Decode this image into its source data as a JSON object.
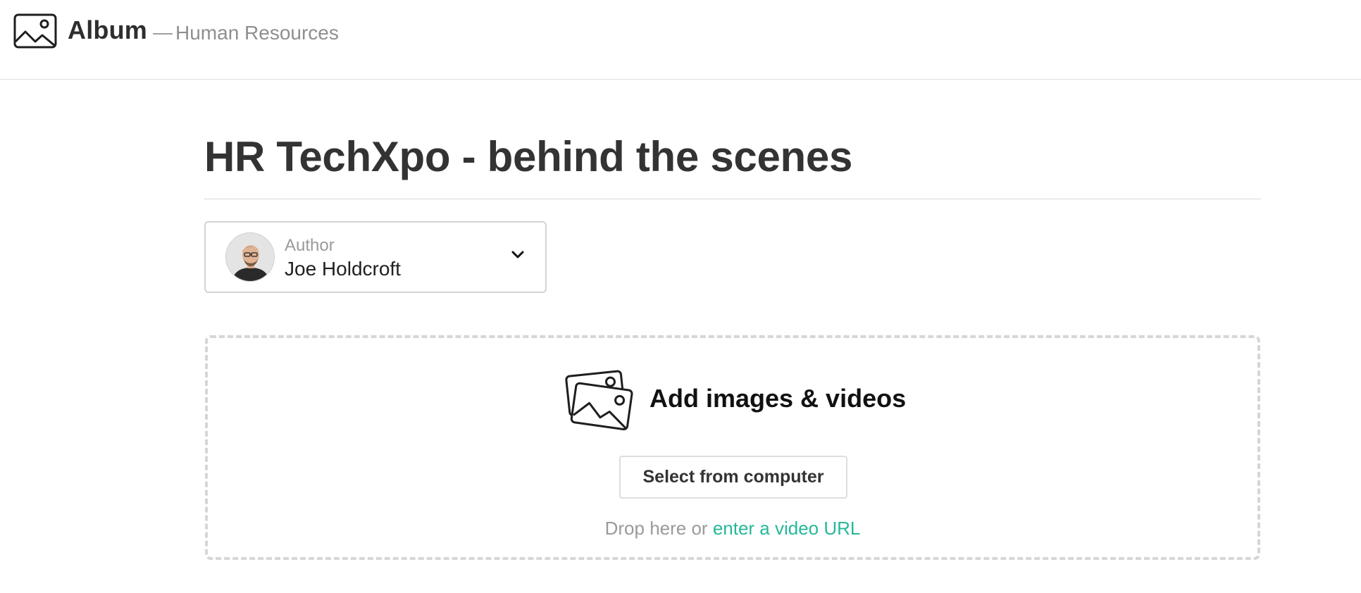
{
  "header": {
    "app_title": "Album",
    "separator": "—",
    "section": "Human Resources",
    "logo_icon": "image-frame-icon"
  },
  "album": {
    "title": "HR TechXpo - behind the scenes"
  },
  "author": {
    "label": "Author",
    "name": "Joe Holdcroft",
    "dropdown_icon": "chevron-down-icon"
  },
  "upload": {
    "icon": "photos-stack-icon",
    "heading": "Add images & videos",
    "button_label": "Select from computer",
    "drop_prefix": "Drop here or ",
    "video_link": "enter a video URL"
  },
  "colors": {
    "link": "#26b899",
    "text": "#333333",
    "muted": "#9a9a9a",
    "border": "#d6d6d6"
  }
}
